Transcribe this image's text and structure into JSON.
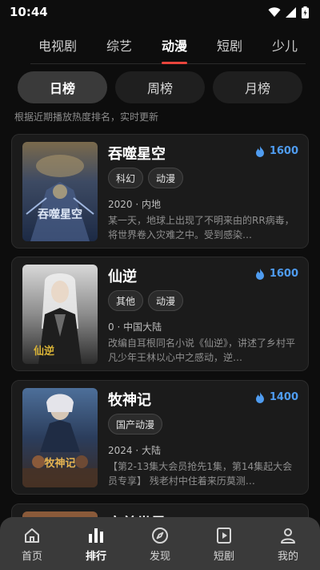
{
  "status_bar": {
    "time": "10:44"
  },
  "category_tabs": [
    {
      "label": "电视剧",
      "active": false
    },
    {
      "label": "综艺",
      "active": false
    },
    {
      "label": "动漫",
      "active": true
    },
    {
      "label": "短剧",
      "active": false
    },
    {
      "label": "少儿",
      "active": false
    }
  ],
  "rank_tabs": [
    {
      "label": "日榜",
      "active": true
    },
    {
      "label": "周榜",
      "active": false
    },
    {
      "label": "月榜",
      "active": false
    }
  ],
  "hint": "根据近期播放热度排名，实时更新",
  "items": [
    {
      "title": "吞噬星空",
      "heat": "1600",
      "tags": [
        "科幻",
        "动漫"
      ],
      "meta": "2020 · 内地",
      "desc": "某一天，地球上出现了不明来由的RR病毒，将世界卷入灾难之中。受到感染…",
      "poster_text": "吞噬星空"
    },
    {
      "title": "仙逆",
      "heat": "1600",
      "tags": [
        "其他",
        "动漫"
      ],
      "meta": "0 · 中国大陆",
      "desc": "改编自耳根同名小说《仙逆》，讲述了乡村平凡少年王林以心中之感动，逆…",
      "poster_text": "仙逆"
    },
    {
      "title": "牧神记",
      "heat": "1400",
      "tags": [
        "国产动漫"
      ],
      "meta": "2024 · 大陆",
      "desc": "【第2-13集大会员抢先1集，第14集起大会员专享】 残老村中住着来历莫测…",
      "poster_text": "牧神记"
    },
    {
      "title": "完美世界",
      "heat": "",
      "tags": [],
      "meta": "",
      "desc": ""
    }
  ],
  "bottom_nav": [
    {
      "label": "首页",
      "icon": "home-icon",
      "active": false
    },
    {
      "label": "排行",
      "icon": "ranking-icon",
      "active": true
    },
    {
      "label": "发现",
      "icon": "compass-icon",
      "active": false
    },
    {
      "label": "短剧",
      "icon": "play-icon",
      "active": false
    },
    {
      "label": "我的",
      "icon": "user-icon",
      "active": false
    }
  ],
  "colors": {
    "background": "#0d0d0d",
    "card": "#1b1b1b",
    "accent_tab_indicator": "#e8453c",
    "heat_blue": "#4f9cf0",
    "bottom_nav": "#3a3a3a"
  }
}
